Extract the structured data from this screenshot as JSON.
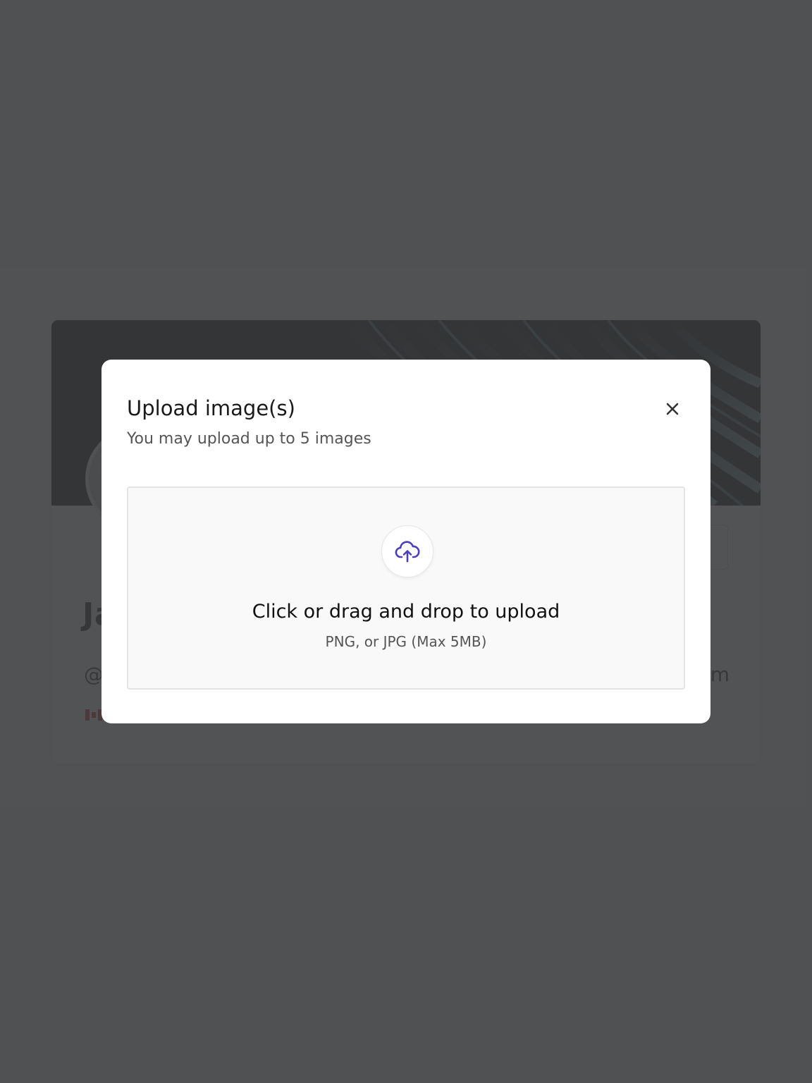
{
  "background": {
    "profile": {
      "name_visible": "Ja",
      "handle_visible": "@",
      "handle_end_visible": "m"
    }
  },
  "modal": {
    "title": "Upload image(s)",
    "subtitle": "You may upload up to 5 images",
    "close_icon": "close-icon",
    "dropzone": {
      "icon": "cloud-upload-icon",
      "title": "Click or drag and drop to upload",
      "hint": "PNG, or JPG (Max 5MB)"
    }
  },
  "colors": {
    "accent": "#4b3fbf",
    "overlay": "#3a3b3d"
  }
}
